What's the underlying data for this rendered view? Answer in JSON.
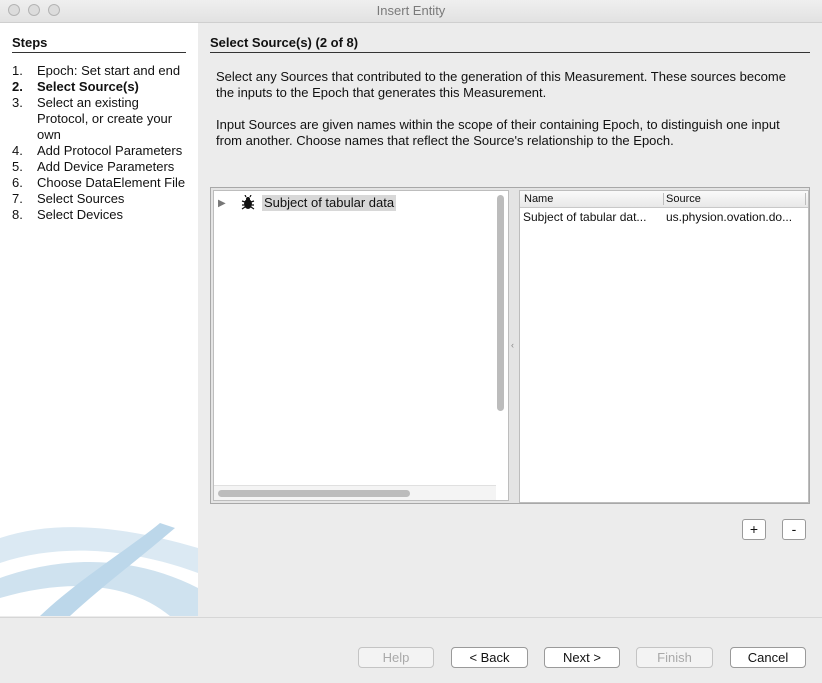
{
  "window": {
    "title": "Insert Entity"
  },
  "steps": {
    "header": "Steps",
    "items": [
      {
        "num": "1.",
        "label": "Epoch: Set start and end"
      },
      {
        "num": "2.",
        "label": "Select Source(s)"
      },
      {
        "num": "3.",
        "label": "Select an existing Protocol, or create your own"
      },
      {
        "num": "4.",
        "label": "Add Protocol Parameters"
      },
      {
        "num": "5.",
        "label": "Add Device Parameters"
      },
      {
        "num": "6.",
        "label": "Choose DataElement File"
      },
      {
        "num": "7.",
        "label": "Select Sources"
      },
      {
        "num": "8.",
        "label": "Select Devices"
      }
    ]
  },
  "main": {
    "title": "Select Source(s) (2 of 8)",
    "description_1": "Select any Sources that contributed to the generation of this Measurement. These sources become the inputs to the Epoch that generates this Measurement.",
    "description_2": "Input Sources are given names within the scope of their containing Epoch, to distinguish one input from another. Choose names that reflect the Source's relationship to the Epoch."
  },
  "tree": {
    "items": [
      {
        "label": "Subject of tabular data",
        "icon": "bug-icon"
      }
    ]
  },
  "table": {
    "columns": [
      "Name",
      "Source"
    ],
    "rows": [
      [
        "Subject of tabular dat...",
        "us.physion.ovation.do..."
      ]
    ]
  },
  "controls": {
    "add_label": "+",
    "remove_label": "-"
  },
  "footer": {
    "help": "Help",
    "back": "< Back",
    "next": "Next >",
    "finish": "Finish",
    "cancel": "Cancel"
  }
}
